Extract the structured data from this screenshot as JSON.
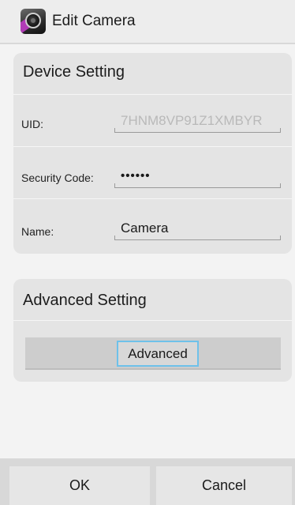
{
  "header": {
    "title": "Edit Camera",
    "icon": "camera-live-app-icon"
  },
  "device_setting": {
    "title": "Device Setting",
    "uid_label": "UID:",
    "uid_value": "7HNM8VP91Z1XMBYR",
    "security_label": "Security Code:",
    "security_value": "••••••",
    "name_label": "Name:",
    "name_value": "Camera"
  },
  "advanced_setting": {
    "title": "Advanced Setting",
    "button_label": "Advanced"
  },
  "footer": {
    "ok_label": "OK",
    "cancel_label": "Cancel"
  },
  "colors": {
    "focus_border": "#6ec1ea",
    "card_background": "#e4e4e4"
  }
}
